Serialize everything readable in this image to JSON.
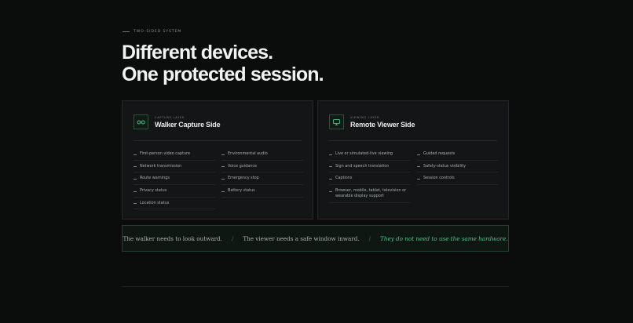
{
  "section": {
    "eyebrow": "TWO-SIDED SYSTEM",
    "headline_line1": "Different devices.",
    "headline_line2": "One protected session."
  },
  "walker": {
    "tag": "CAPTURE LAYER",
    "title": "Walker Capture Side",
    "icon": "glasses-icon",
    "items": [
      "First-person video capture",
      "Environmental audio",
      "Network transmission",
      "Voice guidance",
      "Route warnings",
      "Emergency stop",
      "Privacy status",
      "Battery status",
      "Location status"
    ]
  },
  "viewer": {
    "tag": "VIEWING LAYER",
    "title": "Remote Viewer Side",
    "icon": "monitor-icon",
    "items": [
      "Live or simulated-live viewing",
      "Guided requests",
      "Sign and speech translation",
      "Safety-status visibility",
      "Captions",
      "Session controls",
      "Browser, mobile, tablet, television or wearable display support"
    ]
  },
  "statement": {
    "part1": "The walker needs to look outward.",
    "separator": "/",
    "part2": "The viewer needs a safe window inward.",
    "part3": "They do not need to use the same hardware."
  },
  "colors": {
    "background": "#0b0c0c",
    "panel": "#131516",
    "accent": "#4fc487",
    "accent_border": "#1f4433"
  }
}
